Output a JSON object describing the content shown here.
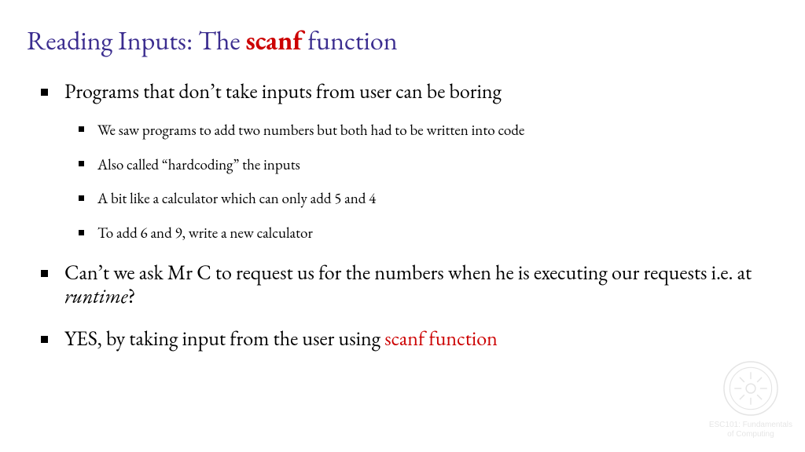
{
  "title": {
    "part1": "Reading Inputs: The ",
    "part2": "scanf",
    "part3": " function"
  },
  "bullets": {
    "b1": "Programs that don’t take inputs from user can be boring",
    "sub": {
      "s1": "We saw programs to add two numbers but both had to be written into code",
      "s2": "Also called “hardcoding” the inputs",
      "s3": "A bit like a calculator which can only add 5 and 4",
      "s4": "To add 6 and 9, write a new calculator"
    },
    "b2": {
      "a": "Can’t we ask Mr C to request us for the numbers when he is executing our requests i.e. at ",
      "b": "runtime",
      "c": "?"
    },
    "b3": {
      "a": "YES, by taking input from the user using ",
      "b": "scanf  function"
    }
  },
  "watermark": {
    "line1": "ESC101: Fundamentals",
    "line2": "of Computing"
  }
}
